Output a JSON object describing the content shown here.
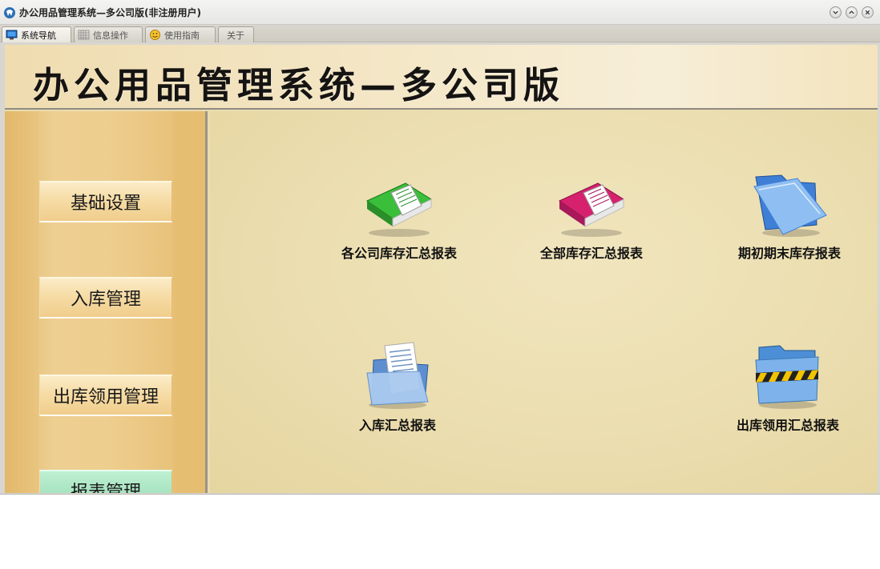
{
  "window": {
    "title": "办公用品管理系统—多公司版(非注册用户)"
  },
  "tabs": [
    {
      "label": "系统导航",
      "icon": "monitor-icon",
      "active": true
    },
    {
      "label": "信息操作",
      "icon": "grid-icon",
      "active": false
    },
    {
      "label": "使用指南",
      "icon": "smiley-icon",
      "active": false
    },
    {
      "label": "关于",
      "icon": "",
      "active": false
    }
  ],
  "banner": {
    "title": "办公用品管理系统—多公司版"
  },
  "sidebar": {
    "items": [
      {
        "label": "基础设置",
        "active": false
      },
      {
        "label": "入库管理",
        "active": false
      },
      {
        "label": "出库领用管理",
        "active": false
      },
      {
        "label": "报表管理",
        "active": true
      }
    ]
  },
  "main": {
    "tiles": [
      {
        "label": "各公司库存汇总报表",
        "icon": "green-book-icon"
      },
      {
        "label": "全部库存汇总报表",
        "icon": "pink-book-icon"
      },
      {
        "label": "期初期末库存报表",
        "icon": "blue-folder-icon"
      },
      {
        "label": "入库汇总报表",
        "icon": "document-folder-icon"
      },
      {
        "label": "出库领用汇总报表",
        "icon": "caution-folder-icon"
      }
    ]
  },
  "colors": {
    "sidebar_bg": "#e6bd70",
    "main_bg": "#ecdfb2",
    "banner_bg": "#f4e7c7",
    "active_menu": "#a9e5c2"
  }
}
